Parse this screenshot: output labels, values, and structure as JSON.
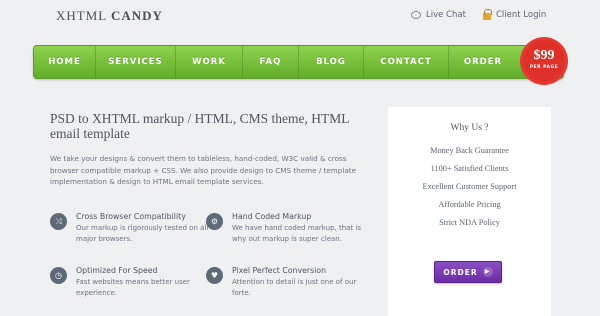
{
  "header": {
    "logo_light": "XHTML",
    "logo_bold": "CANDY",
    "live_chat": "Live Chat",
    "client_login": "Client Login"
  },
  "nav": {
    "items": [
      "HOME",
      "SERVICES",
      "WORK",
      "FAQ",
      "BLOG",
      "CONTACT",
      "ORDER"
    ]
  },
  "badge": {
    "price": "$99",
    "per": "PER PAGE"
  },
  "main": {
    "headline": "PSD to XHTML markup / HTML, CMS theme, HTML email template",
    "intro": "We take your designs & convert them to tableless, hand-coded, W3C valid & cross browser compatible markup + CSS. We also provide design to CMS theme / template implementation & design to HTML email template services.",
    "features": [
      {
        "title": "Cross Browser Compatibility",
        "desc": "Our markup is rigorously tested on all major browsers.",
        "icon": "shuffle-icon"
      },
      {
        "title": "Hand Coded Markup",
        "desc": "We have hand coded markup, that is why out markup is super clean.",
        "icon": "gear-icon"
      },
      {
        "title": "Optimized For Speed",
        "desc": "Fast websites means better user experience.",
        "icon": "stopwatch-icon"
      },
      {
        "title": "Pixel Perfect Conversion",
        "desc": "Attention to detail is just one of our forte.",
        "icon": "heart-icon"
      }
    ]
  },
  "why": {
    "title": "Why Us ?",
    "items": [
      "Money Back Guarantee",
      "1100+ Satisfied Clients",
      "Excellent Customer Support",
      "Affordable Pricing",
      "Strict NDA Policy"
    ],
    "order_label": "ORDER"
  },
  "colors": {
    "nav_green": "#6fbf35",
    "badge_red": "#e0302a",
    "order_purple": "#7a3bb5"
  }
}
